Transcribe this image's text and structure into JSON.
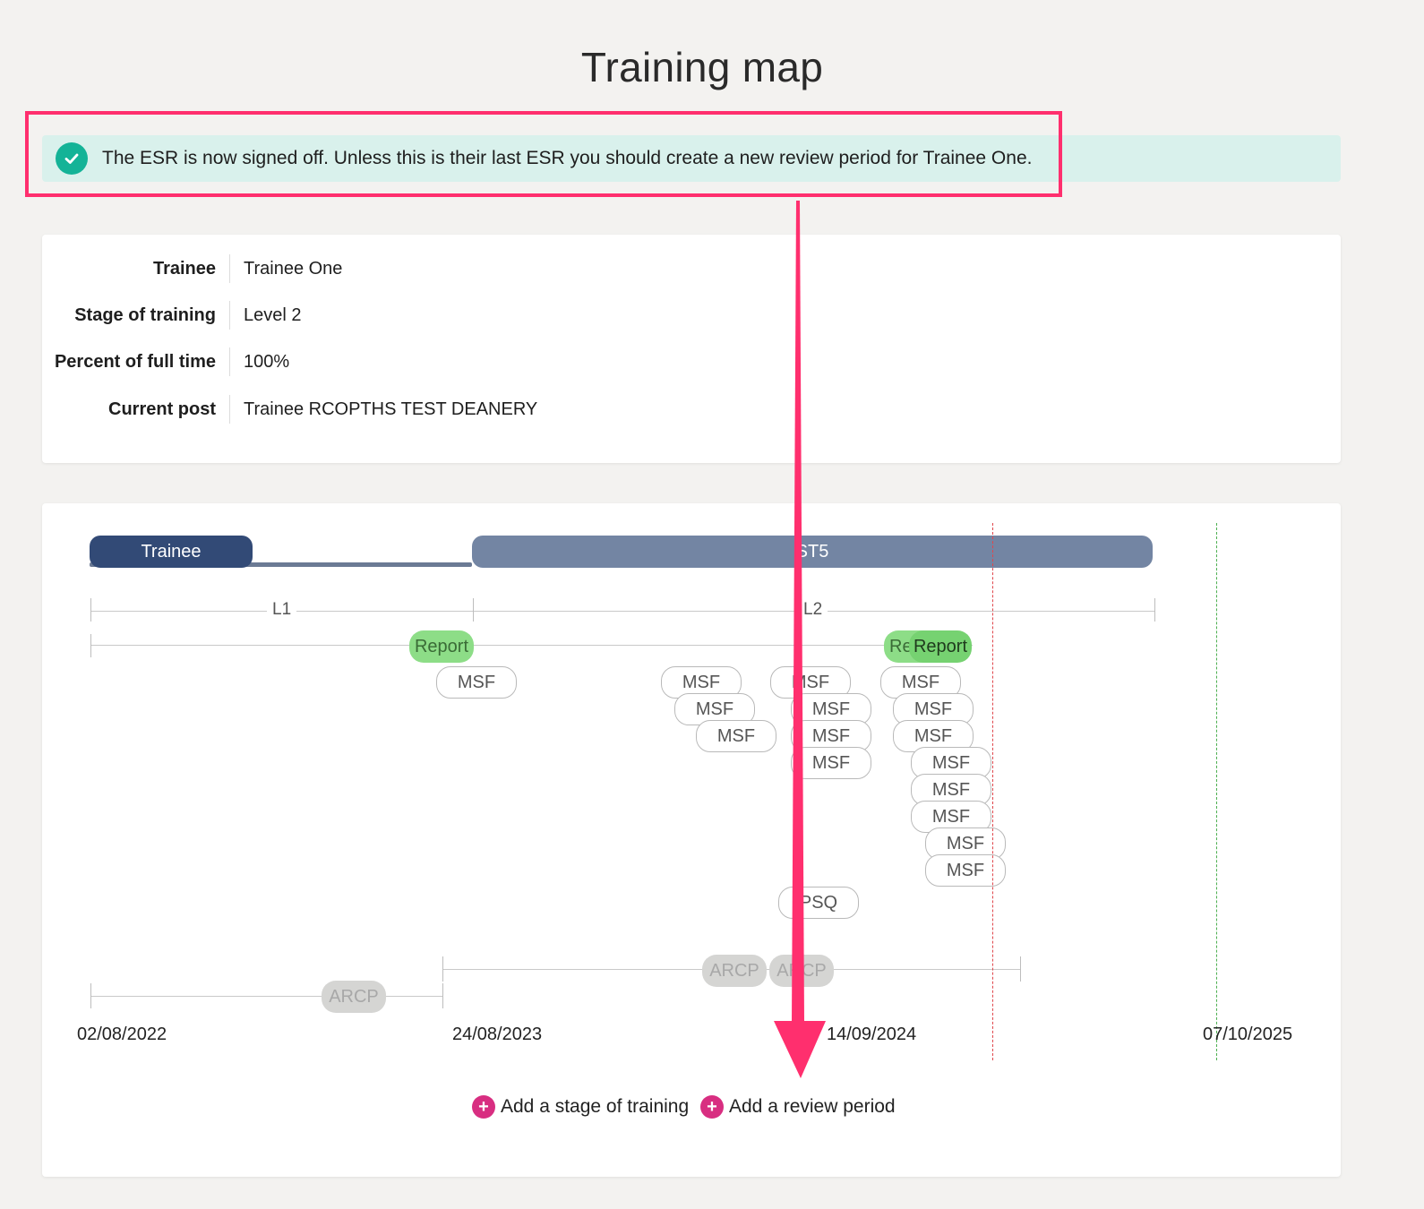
{
  "page": {
    "title": "Training map"
  },
  "alert": {
    "message": "The ESR is now signed off. Unless this is their last ESR you should create a new review period for Trainee One.",
    "icon": "check-circle-icon",
    "accent": "#14b397",
    "highlight_color": "#ff2f6e"
  },
  "info": {
    "rows": [
      {
        "label": "Trainee",
        "value": "Trainee One"
      },
      {
        "label": "Stage of training",
        "value": "Level 2"
      },
      {
        "label": "Percent of full time",
        "value": "100%"
      },
      {
        "label": "Current post",
        "value": "Trainee RCOPTHS TEST DEANERY"
      }
    ]
  },
  "map": {
    "stages": [
      {
        "label": "Trainee",
        "color": "#324a76"
      },
      {
        "label": "ST5",
        "color": "#7385a3"
      }
    ],
    "levels": [
      "L1",
      "L2"
    ],
    "reports": [
      "Report",
      "Re",
      "Report"
    ],
    "msf_label": "MSF",
    "psq_label": "PSQ",
    "arcp_label": "ARCP",
    "dates": [
      "02/08/2022",
      "24/08/2023",
      "14/09/2024",
      "07/10/2025"
    ],
    "today_line_color": "#e0464b",
    "end_line_color": "#4caf50"
  },
  "actions": {
    "add_stage": "Add a stage of training",
    "add_review": "Add a review period"
  }
}
